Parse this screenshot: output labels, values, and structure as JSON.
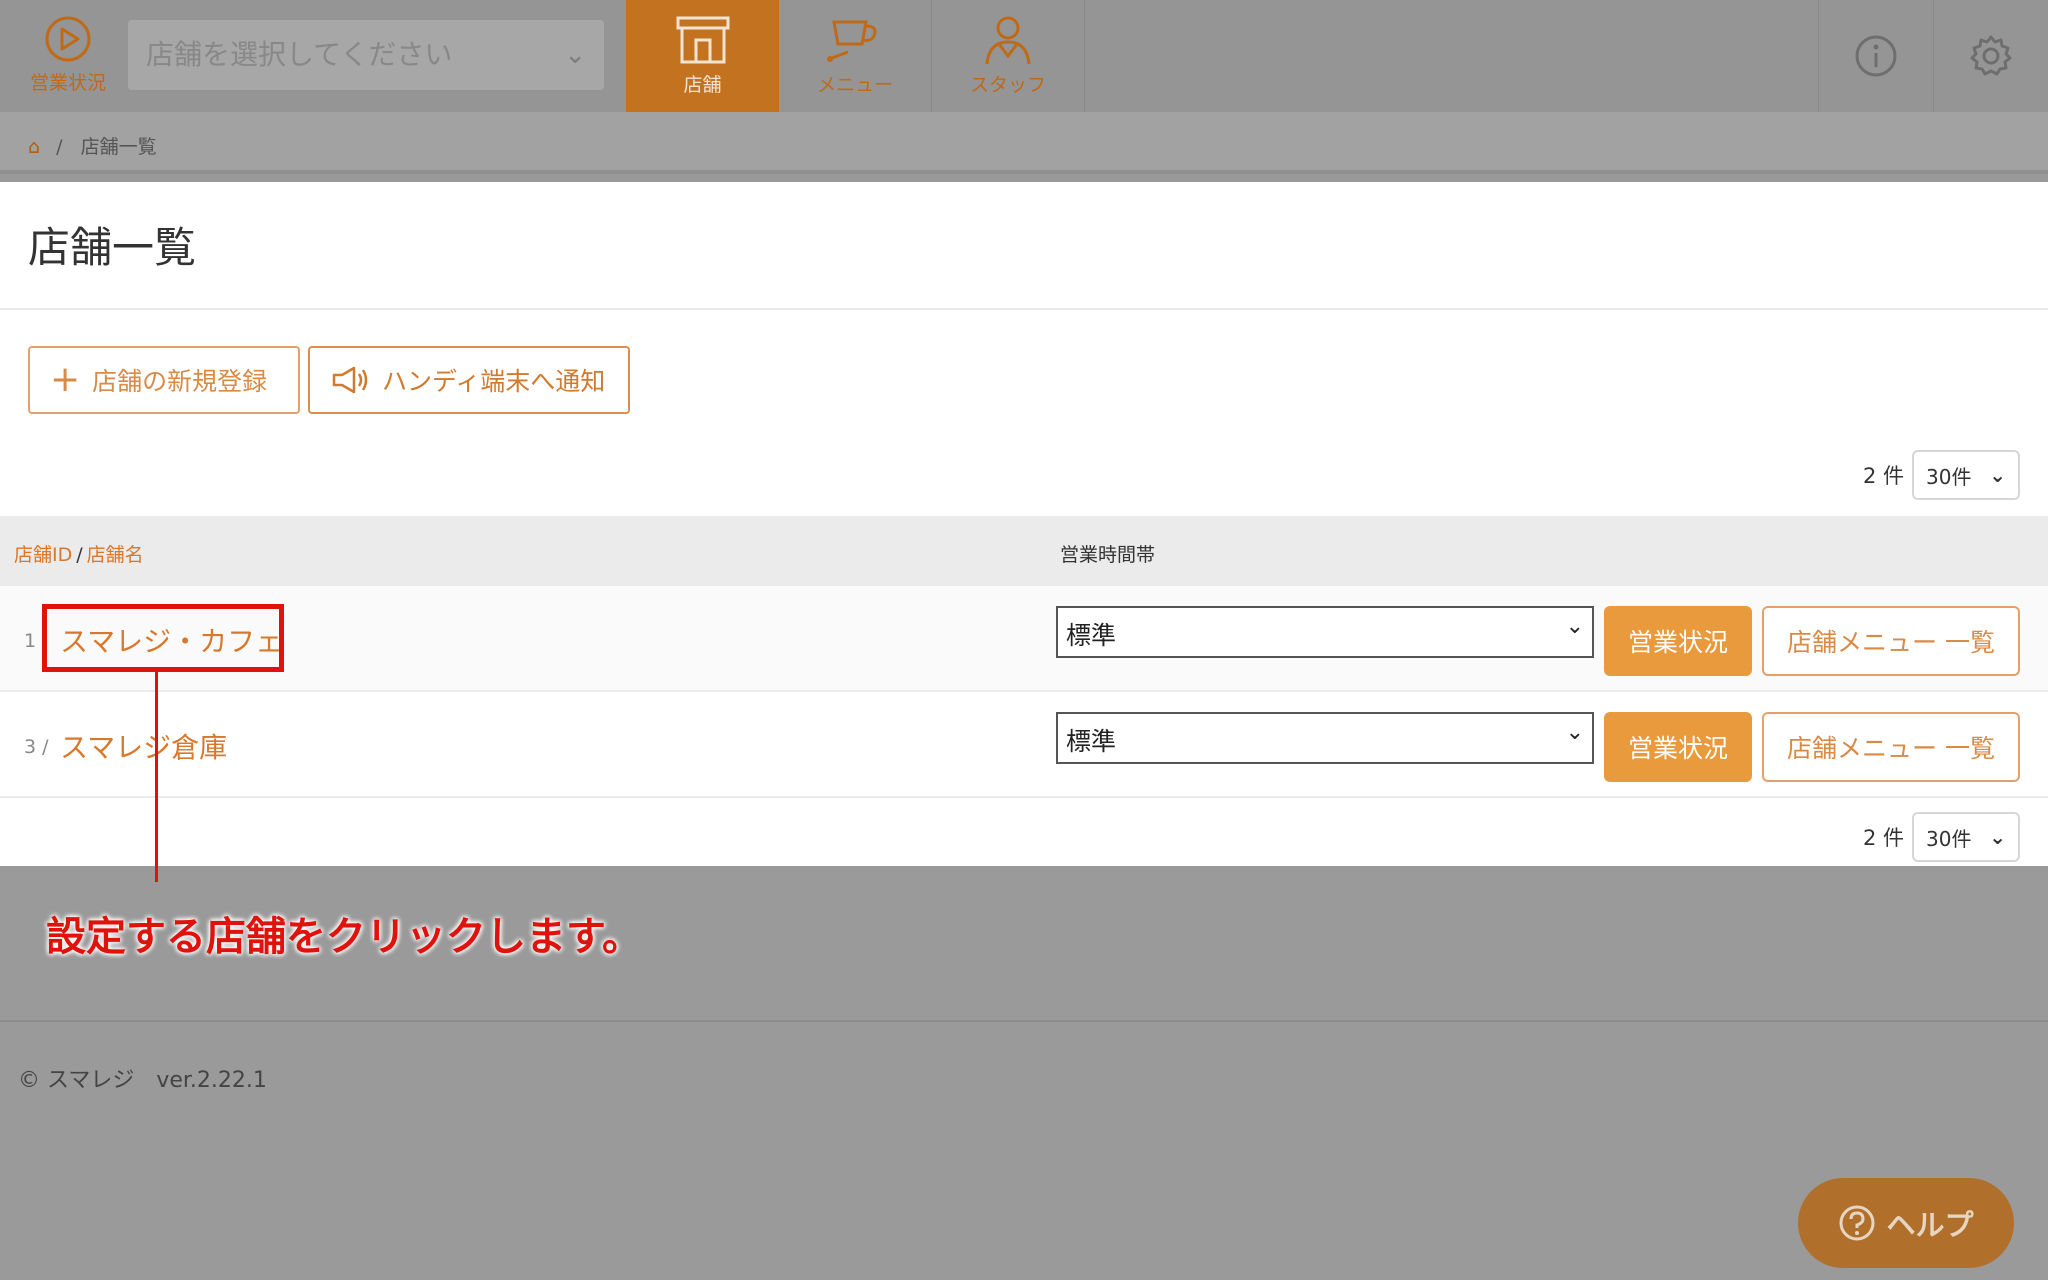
{
  "nav": {
    "status_label": "営業状況",
    "store_select_placeholder": "店舗を選択してください",
    "tabs": [
      {
        "label": "店舗",
        "icon": "storefront-icon"
      },
      {
        "label": "メニュー",
        "icon": "coffee-cup-icon"
      },
      {
        "label": "スタッフ",
        "icon": "staff-icon"
      }
    ],
    "right_icons": [
      "info-icon",
      "gear-icon"
    ]
  },
  "breadcrumb": {
    "current": "店舗一覧",
    "separator": "/"
  },
  "page": {
    "title": "店舗一覧",
    "new_store_button": "店舗の新規登録",
    "notify_button": "ハンディ端末へ通知",
    "count_text": "2 件",
    "per_page": "30件"
  },
  "table": {
    "header_id": "店舗ID",
    "header_sep": "/",
    "header_name": "店舗名",
    "header_hours": "営業時間帯",
    "rows": [
      {
        "id": "1",
        "name": "スマレジ・カフェ",
        "hours": "標準",
        "status_button": "営業状況",
        "menu_button": "店舗メニュー 一覧"
      },
      {
        "id": "3 /",
        "name": "スマレジ倉庫",
        "hours": "標準",
        "status_button": "営業状況",
        "menu_button": "店舗メニュー 一覧"
      }
    ]
  },
  "annotation": {
    "text": "設定する店舗をクリックします。",
    "color": "#e0120c"
  },
  "footer": {
    "copyright": "© スマレジ　ver.2.22.1"
  },
  "help": {
    "label": "ヘルプ"
  },
  "colors": {
    "accent": "#c3731f",
    "link": "#d9772a",
    "button": "#e89a3d"
  }
}
